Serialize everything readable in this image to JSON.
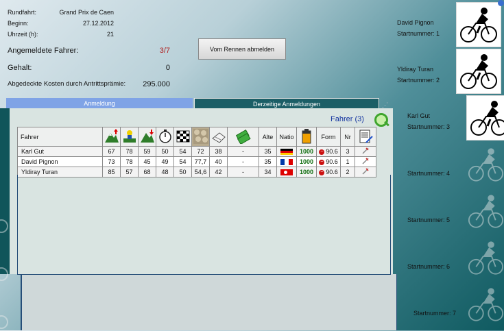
{
  "race_info": {
    "rundfahrt_label": "Rundfahrt:",
    "rundfahrt_value": "Grand Prix de Caen",
    "beginn_label": "Beginn:",
    "beginn_value": "27.12.2012",
    "uhrzeit_label": "Uhrzeit (h):",
    "uhrzeit_value": "21",
    "angemeldete_label": "Angemeldete Fahrer:",
    "angemeldete_value": "3/7",
    "gehalt_label": "Gehalt:",
    "gehalt_value": "0",
    "kosten_label": "Abgedeckte Kosten durch Antrittsprämie:",
    "kosten_value": "295.000"
  },
  "buttons": {
    "abmelden": "Vom Rennen abmelden"
  },
  "tabs": [
    {
      "label": "Anmeldung"
    },
    {
      "label": "Derzeitige Anmeldungen"
    }
  ],
  "tab_handle": "⋰",
  "fahrer_count": "Fahrer  (3)",
  "table": {
    "headers": {
      "fahrer": "Fahrer",
      "alter": "Alte",
      "nation": "Natio",
      "form": "Form",
      "nr": "Nr"
    },
    "dash": "-",
    "rows": [
      {
        "name": "Karl Gut",
        "v1": "67",
        "v2": "78",
        "v3": "59",
        "v4": "50",
        "v5": "54",
        "v6": "72",
        "v7": "38",
        "alter": "35",
        "flag": "de",
        "fitness": "1000",
        "form": "90.6",
        "nr": "3"
      },
      {
        "name": "David Pignon",
        "v1": "73",
        "v2": "78",
        "v3": "45",
        "v4": "49",
        "v5": "54",
        "v6": "77,7",
        "v7": "40",
        "alter": "35",
        "flag": "fr",
        "fitness": "1000",
        "form": "90.6",
        "nr": "1"
      },
      {
        "name": "Yldiray Turan",
        "v1": "85",
        "v2": "57",
        "v3": "68",
        "v4": "48",
        "v5": "50",
        "v6": "54,6",
        "v7": "42",
        "alter": "34",
        "flag": "tr",
        "fitness": "1000",
        "form": "90.6",
        "nr": "2"
      }
    ]
  },
  "riders": [
    {
      "name": "David Pignon",
      "nr": "Startnummer: 1"
    },
    {
      "name": "Yldiray Turan",
      "nr": "Startnummer: 2"
    },
    {
      "name": "Karl Gut",
      "nr": "Startnummer: 3"
    },
    {
      "nr": "Startnummer: 4"
    },
    {
      "nr": "Startnummer: 5"
    },
    {
      "nr": "Startnummer: 6"
    },
    {
      "nr": "Startnummer: 7"
    }
  ],
  "icons": {
    "mountain_up": "mountain-climb-icon",
    "sprinter": "sprinter-icon",
    "downhill": "downhill-icon",
    "stopwatch": "time-trial-icon",
    "finish_flag": "finish-flag-icon",
    "cobbles": "cobblestone-icon",
    "stamina": "stamina-icon",
    "money": "money-icon",
    "battery": "battery-icon",
    "notes": "notes-icon",
    "cyclist": "cyclist-icon"
  },
  "colors": {
    "tab_active": "#7fa3e6",
    "tab_inactive": "#1b5e66",
    "count_text": "#1535a0",
    "fraction_red": "#b02222"
  }
}
